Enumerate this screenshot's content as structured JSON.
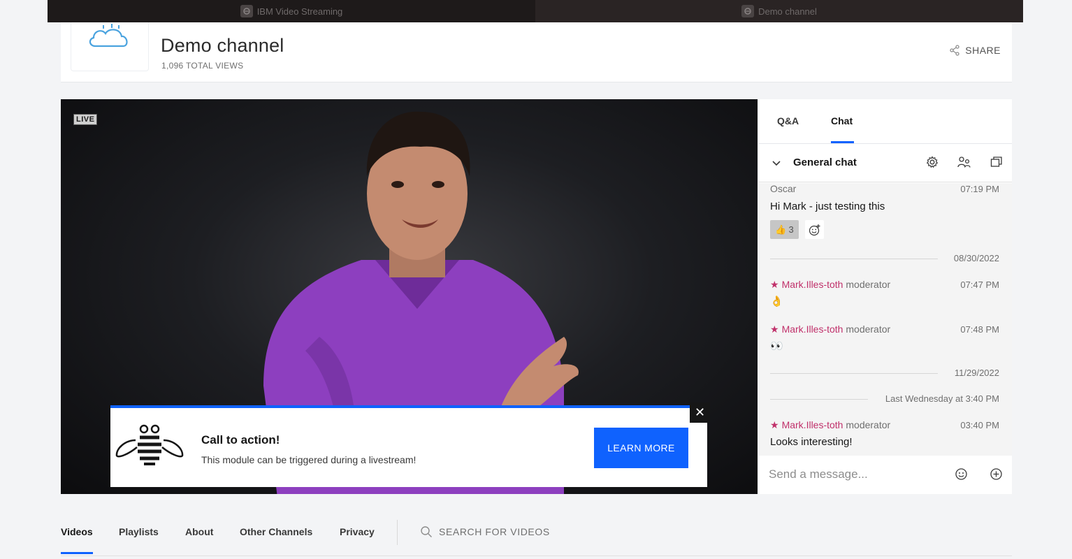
{
  "browser": {
    "tabs": [
      {
        "label": "IBM Video Streaming",
        "icon": "bee-favicon-icon"
      },
      {
        "label": "Demo channel",
        "icon": "bee-favicon-icon"
      }
    ]
  },
  "channel": {
    "title": "Demo channel",
    "views": "1,096 TOTAL VIEWS",
    "share_label": "SHARE",
    "logo_icon": "cloud-icon"
  },
  "player": {
    "live_badge": "LIVE"
  },
  "cta": {
    "title": "Call to action!",
    "text": "This module can be triggered during a livestream!",
    "button_label": "LEARN MORE",
    "close_label": "✕",
    "icon": "bee-icon"
  },
  "side": {
    "tabs": [
      {
        "label": "Q&A"
      },
      {
        "label": "Chat"
      }
    ],
    "active_tab": "Chat",
    "chat_title": "General chat",
    "messages": [
      {
        "name": "Oscar",
        "time": "07:19 PM",
        "text": "Hi Mark - just testing this",
        "reaction": {
          "emoji": "👍",
          "count": "3"
        }
      },
      {
        "date": "08/30/2022"
      },
      {
        "name": "Mark.Illes-toth",
        "role": "moderator",
        "time": "07:47 PM",
        "text": "👌"
      },
      {
        "name": "Mark.Illes-toth",
        "role": "moderator",
        "time": "07:48 PM",
        "text": "👀"
      },
      {
        "date": "11/29/2022"
      },
      {
        "date": "Last Wednesday at 3:40 PM"
      },
      {
        "name": "Mark.Illes-toth",
        "role": "moderator",
        "time": "03:40 PM",
        "text": "Looks interesting!"
      }
    ],
    "input_placeholder": "Send a message..."
  },
  "bottom_nav": {
    "items": [
      {
        "label": "Videos"
      },
      {
        "label": "Playlists"
      },
      {
        "label": "About"
      },
      {
        "label": "Other Channels"
      },
      {
        "label": "Privacy"
      }
    ],
    "active": "Videos",
    "search_label": "SEARCH FOR VIDEOS"
  },
  "colors": {
    "accent": "#0f62fe",
    "moderator": "#c0306a",
    "background": "#f3f4f6"
  }
}
